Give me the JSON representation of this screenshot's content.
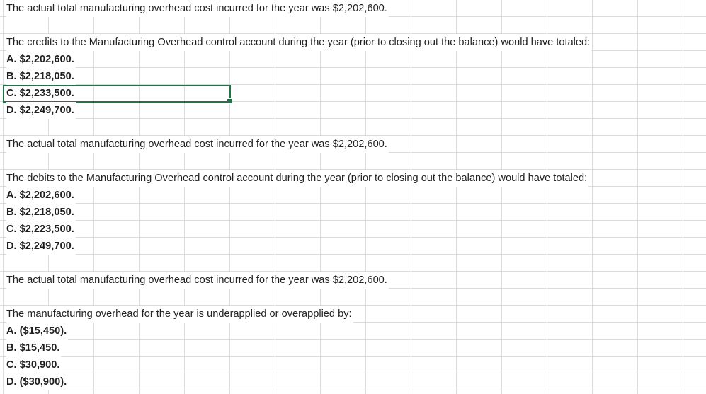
{
  "rows": [
    {
      "text": "The actual total manufacturing overhead cost incurred for the year was $2,202,600.",
      "kind": "text"
    },
    {
      "text": "",
      "kind": "empty"
    },
    {
      "text": "The credits to the Manufacturing Overhead control account during the year (prior to closing out the balance) would have totaled:",
      "kind": "text"
    },
    {
      "text": "A. $2,202,600.",
      "kind": "option"
    },
    {
      "text": "B. $2,218,050.",
      "kind": "option"
    },
    {
      "text": "C. $2,233,500.",
      "kind": "option"
    },
    {
      "text": "D. $2,249,700.",
      "kind": "option"
    },
    {
      "text": "",
      "kind": "empty"
    },
    {
      "text": "The actual total manufacturing overhead cost incurred for the year was $2,202,600.",
      "kind": "text"
    },
    {
      "text": "",
      "kind": "empty"
    },
    {
      "text": "The debits to the Manufacturing Overhead control account during the year (prior to closing out the balance) would have totaled:",
      "kind": "text"
    },
    {
      "text": "A. $2,202,600.",
      "kind": "option"
    },
    {
      "text": "B. $2,218,050.",
      "kind": "option"
    },
    {
      "text": "C. $2,223,500.",
      "kind": "option"
    },
    {
      "text": "D. $2,249,700.",
      "kind": "option"
    },
    {
      "text": "",
      "kind": "empty"
    },
    {
      "text": "The actual total manufacturing overhead cost incurred for the year was $2,202,600.",
      "kind": "text"
    },
    {
      "text": "",
      "kind": "empty"
    },
    {
      "text": "The manufacturing overhead for the year is underapplied or overapplied by:",
      "kind": "text"
    },
    {
      "text": "A. ($15,450).",
      "kind": "option"
    },
    {
      "text": "B. $15,450.",
      "kind": "option"
    },
    {
      "text": "C. $30,900.",
      "kind": "option"
    },
    {
      "text": "D. ($30,900).",
      "kind": "option"
    }
  ],
  "selected_row_index": 5,
  "colors": {
    "gridline": "#dadcdf",
    "selection": "#217346",
    "text": "#222222"
  }
}
